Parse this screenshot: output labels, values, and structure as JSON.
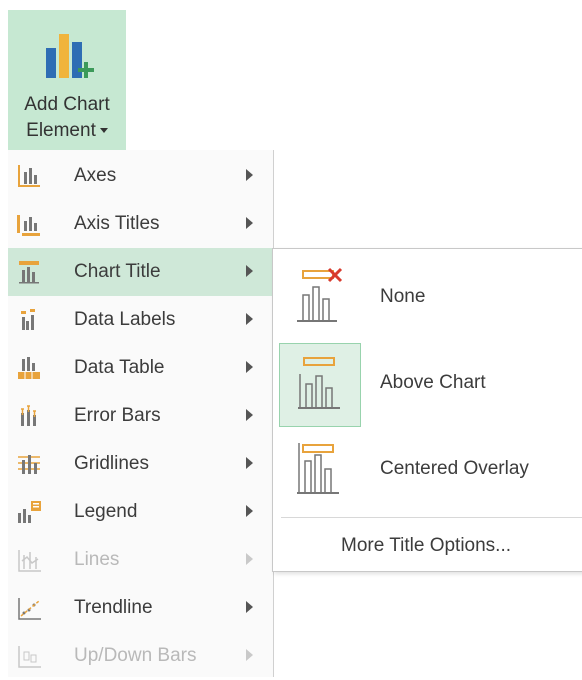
{
  "ribbon": {
    "button_line1": "Add Chart",
    "button_line2": "Element",
    "icon": "add-chart-element-icon"
  },
  "menu": {
    "items": [
      {
        "label": "Axes",
        "icon": "axes-icon",
        "enabled": true,
        "highlighted": false
      },
      {
        "label": "Axis Titles",
        "icon": "axis-titles-icon",
        "enabled": true,
        "highlighted": false
      },
      {
        "label": "Chart Title",
        "icon": "chart-title-icon",
        "enabled": true,
        "highlighted": true
      },
      {
        "label": "Data Labels",
        "icon": "data-labels-icon",
        "enabled": true,
        "highlighted": false
      },
      {
        "label": "Data Table",
        "icon": "data-table-icon",
        "enabled": true,
        "highlighted": false
      },
      {
        "label": "Error Bars",
        "icon": "error-bars-icon",
        "enabled": true,
        "highlighted": false
      },
      {
        "label": "Gridlines",
        "icon": "gridlines-icon",
        "enabled": true,
        "highlighted": false
      },
      {
        "label": "Legend",
        "icon": "legend-icon",
        "enabled": true,
        "highlighted": false
      },
      {
        "label": "Lines",
        "icon": "lines-icon",
        "enabled": false,
        "highlighted": false
      },
      {
        "label": "Trendline",
        "icon": "trendline-icon",
        "enabled": true,
        "highlighted": false
      },
      {
        "label": "Up/Down Bars",
        "icon": "up-down-bars-icon",
        "enabled": false,
        "highlighted": false
      }
    ]
  },
  "submenu": {
    "options": [
      {
        "label": "None",
        "icon": "no-chart-title-icon",
        "selected": false
      },
      {
        "label": "Above Chart",
        "icon": "title-above-chart-icon",
        "selected": true
      },
      {
        "label": "Centered Overlay",
        "icon": "centered-overlay-title-icon",
        "selected": false
      }
    ],
    "more": "More Title Options..."
  },
  "colors": {
    "ribbon_highlight": "#c6e8d2",
    "menu_highlight": "#cfe8d8",
    "selected_border": "#98d3ad",
    "accent_orange": "#e8a33c",
    "accent_red": "#d83b2e"
  }
}
